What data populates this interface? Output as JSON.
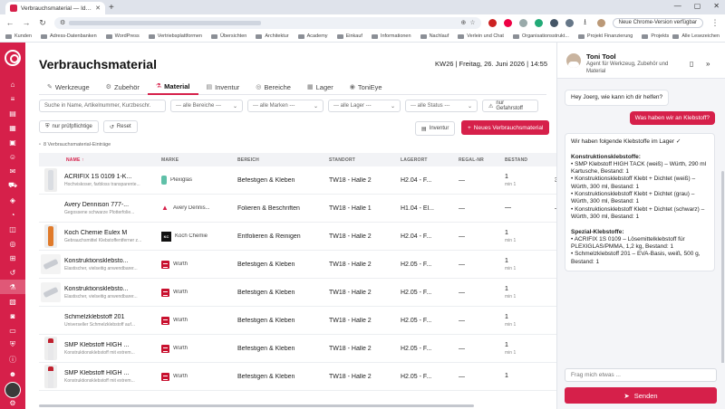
{
  "browser": {
    "tab_title": "Verbrauchsmaterial — Identi...",
    "update_label": "Neue Chrome-Version verfügbar",
    "bookmarks": [
      "Kunden",
      "Adress-Datenbanken",
      "WordPress",
      "Vertriebsplattformen",
      "Übersichten",
      "Architektur",
      "Academy",
      "Einkauf",
      "Informationen",
      "Nachlauf",
      "Verlein und Chat",
      "Organisationsstrukt...",
      "Projekt Finanzierung",
      "Projektsoftware"
    ],
    "all_bookmarks": "Alle Lesezeichen"
  },
  "page": {
    "title": "Verbrauchsmaterial",
    "date": "KW26 | Freitag, 26. Juni 2026 | 14:55"
  },
  "tabs": [
    {
      "label": "Werkzeuge",
      "icon": "wrench-icon"
    },
    {
      "label": "Zubehör",
      "icon": "puzzle-icon"
    },
    {
      "label": "Material",
      "icon": "flask-icon",
      "active": true
    },
    {
      "label": "Inventur",
      "icon": "clipboard-icon"
    },
    {
      "label": "Bereiche",
      "icon": "area-icon"
    },
    {
      "label": "Lager",
      "icon": "box-icon"
    },
    {
      "label": "ToniEye",
      "icon": "eye-icon"
    }
  ],
  "filters": {
    "search_placeholder": "Suche in Name, Artikelnummer, Kurzbeschr.",
    "bereiche": "--- alle Bereiche ---",
    "marken": "--- alle Marken ---",
    "lager": "--- alle Lager ---",
    "status": "--- alle Status ---",
    "gefahrstoff": "nur Gefahrstoff",
    "pruef": "nur prüfpflichtige",
    "reset": "Reset",
    "inventur": "Inventur",
    "new": "Neues Verbrauchsmaterial"
  },
  "count_line": "8 Verbrauchsmaterial-Einträge",
  "columns": [
    "NAME",
    "MARKE",
    "BEREICH",
    "STANDORT",
    "LAGERORT",
    "REGAL-NR",
    "BESTAND",
    "MI"
  ],
  "rows": [
    {
      "thumb": "bottle",
      "name": "ACRIFIX 1S 0109 1-K...",
      "sub": "Hochviskoser, farbloss transparente...",
      "brand": "Plexiglas",
      "logo": "pg",
      "area": "Befestigen & Kleben",
      "loc": "TW18 - Halle 2",
      "lager": "H2.04 - F...",
      "regal": "—",
      "stock": "1",
      "min": "min 1",
      "mo": "31"
    },
    {
      "thumb": "none",
      "name": "Avery Dennison 777-...",
      "sub": "Gegossene schwarze Plotterfolie...",
      "brand": "Avery Dennis...",
      "logo": "ad",
      "area": "Folieren & Beschriften",
      "loc": "TW18 - Halle 1",
      "lager": "H1.04 - El...",
      "regal": "—",
      "stock": "—",
      "min": "",
      "mo": "—"
    },
    {
      "thumb": "orange",
      "name": "Koch Chemie Eulex M",
      "sub": "Gebrauchsmittel Klebstoffentferner z...",
      "brand": "Koch Chemie",
      "logo": "kc",
      "area": "Entfolieren & Reinigen",
      "loc": "TW18 - Halle 2",
      "lager": "H2.04 - F...",
      "regal": "—",
      "stock": "1",
      "min": "min 1",
      "mo": ""
    },
    {
      "thumb": "tube",
      "name": "Konstruktionsklebsto...",
      "sub": "Elastischer, vielseitig anwendbarer...",
      "brand": "Würth",
      "logo": "wu",
      "area": "Befestigen & Kleben",
      "loc": "TW18 - Halle 2",
      "lager": "H2.05 - F...",
      "regal": "—",
      "stock": "1",
      "min": "min 1",
      "mo": ""
    },
    {
      "thumb": "tube",
      "name": "Konstruktionsklebsto...",
      "sub": "Elastischer, vielseitig anwendbarer...",
      "brand": "Würth",
      "logo": "wu",
      "area": "Befestigen & Kleben",
      "loc": "TW18 - Halle 2",
      "lager": "H2.05 - F...",
      "regal": "—",
      "stock": "1",
      "min": "min 1",
      "mo": ""
    },
    {
      "thumb": "none",
      "name": "Schmelzklebstoff 201",
      "sub": "Universeller Schmelzklebstoff auf...",
      "brand": "Würth",
      "logo": "wu",
      "area": "Befestigen & Kleben",
      "loc": "TW18 - Halle 2",
      "lager": "H2.05 - F...",
      "regal": "—",
      "stock": "1",
      "min": "min 1",
      "mo": ""
    },
    {
      "thumb": "red",
      "name": "SMP Klebstoff HIGH ...",
      "sub": "Konstruktionsklebstoff mit extrem...",
      "brand": "Würth",
      "logo": "wu",
      "area": "Befestigen & Kleben",
      "loc": "TW18 - Halle 2",
      "lager": "H2.05 - F...",
      "regal": "—",
      "stock": "1",
      "min": "min 1",
      "mo": ""
    },
    {
      "thumb": "red",
      "name": "SMP Klebstoff HIGH ...",
      "sub": "Konstruktionsklebstoff mit extrem...",
      "brand": "Würth",
      "logo": "wu",
      "area": "Befestigen & Kleben",
      "loc": "TW18 - Halle 2",
      "lager": "H2.05 - F...",
      "regal": "—",
      "stock": "1",
      "min": "",
      "mo": ""
    }
  ],
  "chat": {
    "name": "Toni Tool",
    "subtitle": "Agent für Werkzeug, Zubehör und Material",
    "greeting": "Hey Joerg, wie kann ich dir helfen?",
    "user_msg": "Was haben wir an Klebstoff?",
    "answer": "Wir haben folgende Klebstoffe im Lager ✓\n\n[b]Konstruktionsklebstoffe:[/b]\n• SMP Klebstoff HIGH TACK (weiß) – Würth, 290 ml Kartusche, Bestand: 1\n• Konstruktionsklebstoff Klebt + Dichtet (weiß) – Würth, 300 ml, Bestand: 1\n• Konstruktionsklebstoff Klebt + Dichtet (grau) – Würth, 300 ml, Bestand: 1\n• Konstruktionsklebstoff Klebt + Dichtet (schwarz) – Würth, 300 ml, Bestand: 1\n\n[b]Spezial-Klebstoffe:[/b]\n• ACRIFIX 1S 0109 – Lösemittelklebstoff für PLEXIGLAS/PMMA, 1,2 kg, Bestand: 1\n• Schmelzklebstoff 201 – EVA-Basis, weiß, 500 g, Bestand: 1",
    "input_placeholder": "Frag mich etwas ...",
    "send_label": "Senden"
  },
  "colors": {
    "accent": "#d6204a"
  }
}
